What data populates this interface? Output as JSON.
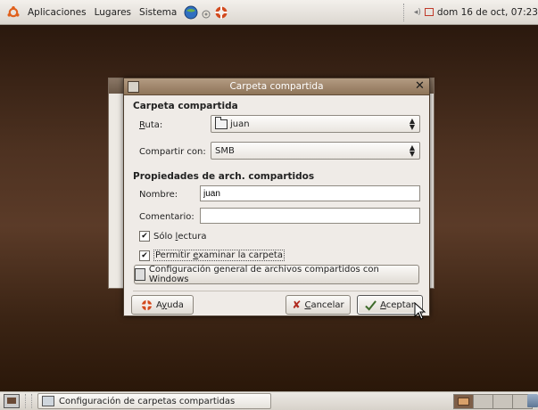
{
  "top_panel": {
    "menus": [
      "Aplicaciones",
      "Lugares",
      "Sistema"
    ],
    "clock": "dom 16 de oct, 07:23"
  },
  "dialog": {
    "title": "Carpeta compartida",
    "section_shared": "Carpeta compartida",
    "path_label_first": "R",
    "path_label_rest": "uta:",
    "path_value": "juan",
    "share_with_label": "Compartir con:",
    "share_with_value": "SMB",
    "section_props": "Propiedades de arch. compartidos",
    "name_label": "Nombre:",
    "name_value": "juan",
    "comment_label": "Comentario:",
    "comment_value": "",
    "readonly_a": "Sólo ",
    "readonly_u": "l",
    "readonly_b": "ectura",
    "readonly_checked": true,
    "browse_a": "Permitir ",
    "browse_u": "e",
    "browse_b": "xaminar la carpeta",
    "browse_checked": true,
    "general_config": "Configuración general de archivos compartidos con Windows",
    "help_a": "A",
    "help_u": "y",
    "help_b": "uda",
    "cancel_u": "C",
    "cancel_b": "ancelar",
    "accept_u": "A",
    "accept_b": "ceptar"
  },
  "taskbar": {
    "task_label": "Configuración de carpetas compartidas"
  },
  "colors": {
    "desktop": "#5b3b28",
    "titlebar": "#a08468",
    "dialog_bg": "#efebe7"
  }
}
